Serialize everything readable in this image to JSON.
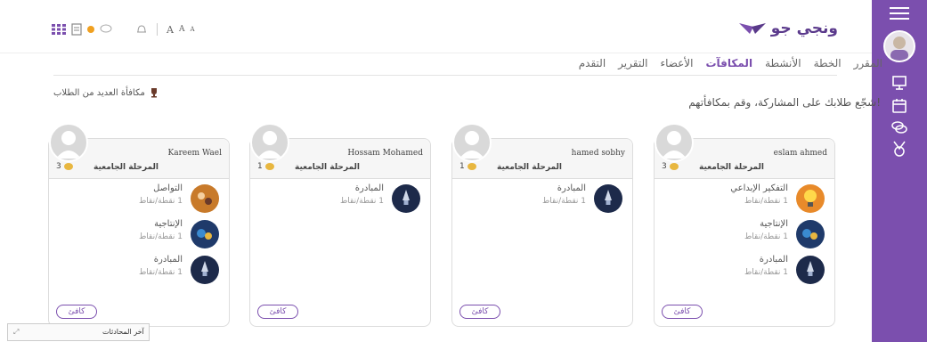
{
  "brand": {
    "name": "ونجي جو"
  },
  "toolbar": {
    "font_a": [
      "A",
      "A",
      "A"
    ]
  },
  "tabs": [
    "المقرر",
    "الخطة",
    "الأنشطة",
    "المكافآت",
    "الأعضاء",
    "التقرير",
    "التقدم"
  ],
  "active_tab": "المكافآت",
  "intro_text": "شجّع طلابك على المشاركة، وقم بمكافأتهم!",
  "reward_many_label": "مكافأة العديد من الطلاب",
  "students": [
    {
      "name": "eslam ahmed",
      "stage": "المرحلة الجامعية",
      "points": "3",
      "badges": [
        {
          "name": "التفكير الإبداعي",
          "points": "1 نقطة/نقاط",
          "icon": "lightbulb-badge"
        },
        {
          "name": "الإنتاجية",
          "points": "1 نقطة/نقاط",
          "icon": "gears-badge"
        },
        {
          "name": "المبادرة",
          "points": "1 نقطة/نقاط",
          "icon": "rocket-badge"
        }
      ],
      "button": "كافئ"
    },
    {
      "name": "hamed sobhy",
      "stage": "المرحلة الجامعية",
      "points": "1",
      "badges": [
        {
          "name": "المبادرة",
          "points": "1 نقطة/نقاط",
          "icon": "rocket-badge"
        }
      ],
      "button": "كافئ"
    },
    {
      "name": "Hossam Mohamed",
      "stage": "المرحلة الجامعية",
      "points": "1",
      "badges": [
        {
          "name": "المبادرة",
          "points": "1 نقطة/نقاط",
          "icon": "rocket-badge"
        }
      ],
      "button": "كافئ"
    },
    {
      "name": "Kareem Wael",
      "stage": "المرحلة الجامعية",
      "points": "3",
      "badges": [
        {
          "name": "التواصل",
          "points": "1 نقطة/نقاط",
          "icon": "communication-badge"
        },
        {
          "name": "الإنتاجية",
          "points": "1 نقطة/نقاط",
          "icon": "gears-badge"
        },
        {
          "name": "المبادرة",
          "points": "1 نقطة/نقاط",
          "icon": "rocket-badge"
        }
      ],
      "button": "كافئ"
    }
  ],
  "chat_bar": {
    "label": "آخر المحادثات"
  },
  "colors": {
    "accent": "#7b4fae",
    "sidebar": "#7b4fae",
    "coin": "#e8b740"
  }
}
